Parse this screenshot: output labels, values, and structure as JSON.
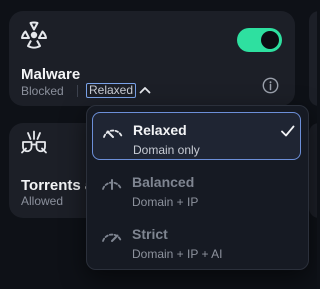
{
  "colors": {
    "background": "#0e1117",
    "card": "#1c1f27",
    "toggle_on": "#2ee0a0",
    "selected_border": "#6c8fd8"
  },
  "malware": {
    "icon": "radiation-icon",
    "title": "Malware",
    "status": "Blocked",
    "mode_label": "Relaxed",
    "toggle_on": true,
    "info_icon": "info-icon"
  },
  "torrents": {
    "icon": "torrent-icon",
    "title": "Torrents a",
    "status": "Allowed"
  },
  "dropdown": {
    "options": [
      {
        "name": "Relaxed",
        "desc": "Domain only",
        "icon": "gauge-low-icon",
        "selected": true
      },
      {
        "name": "Balanced",
        "desc": "Domain + IP",
        "icon": "gauge-medium-icon",
        "selected": false
      },
      {
        "name": "Strict",
        "desc": "Domain + IP + AI",
        "icon": "gauge-high-icon",
        "selected": false
      }
    ]
  }
}
